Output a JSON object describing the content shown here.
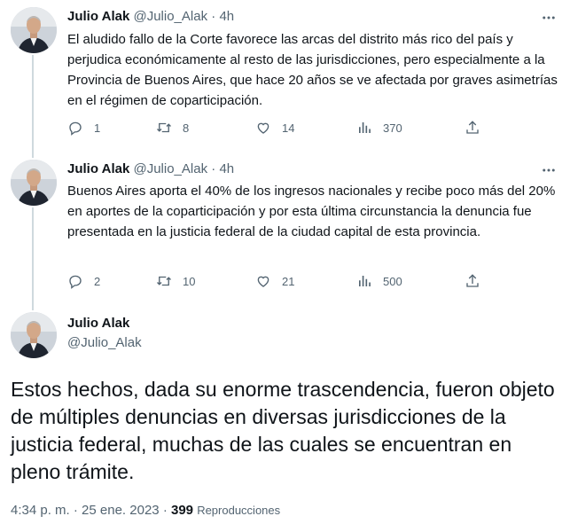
{
  "tweets": [
    {
      "name": "Julio Alak",
      "handle": "@Julio_Alak",
      "separator": "·",
      "time": "4h",
      "text": "El aludido fallo de la Corte favorece las arcas del distrito más rico del país y perjudica económicamente al resto de las jurisdicciones, pero especialmente a la Provincia de Buenos Aires, que hace 20 años se ve afectada por graves asimetrías en el régimen de coparticipación.",
      "replies": "1",
      "retweets": "8",
      "likes": "14",
      "views": "370"
    },
    {
      "name": "Julio Alak",
      "handle": "@Julio_Alak",
      "separator": "·",
      "time": "4h",
      "text": "Buenos Aires aporta el 40% de los ingresos nacionales y recibe poco más del 20% en aportes de la coparticipación y por esta última circunstancia la denuncia fue presentada en la justicia federal de la ciudad capital de esta provincia.",
      "replies": "2",
      "retweets": "10",
      "likes": "21",
      "views": "500"
    }
  ],
  "main_tweet": {
    "name": "Julio Alak",
    "handle": "@Julio_Alak",
    "text": "Estos hechos, dada su enorme trascendencia, fueron objeto de múltiples denuncias en diversas jurisdicciones de la justicia federal, muchas de las cuales se encuentran en pleno trámite.",
    "timestamp": "4:34 p. m.",
    "date": "25 ene. 2023",
    "views": "399",
    "views_label": "Reproducciones",
    "separator": "·"
  },
  "icons": {
    "reply": "reply-icon",
    "retweet": "retweet-icon",
    "like": "like-icon",
    "views": "views-icon",
    "share": "share-icon",
    "more": "more-icon"
  },
  "colors": {
    "text_primary": "#0f1419",
    "text_secondary": "#536471",
    "thread_line": "#cfd9de"
  }
}
